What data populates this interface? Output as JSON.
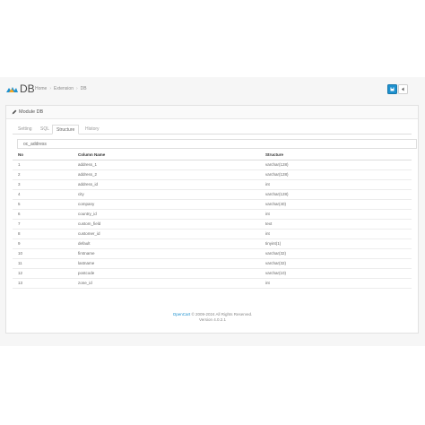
{
  "header": {
    "title": "DB",
    "breadcrumbs": [
      "Home",
      "Extension",
      "DB"
    ]
  },
  "panel": {
    "title": "Module DB"
  },
  "tabs": [
    {
      "label": "Setting",
      "active": false
    },
    {
      "label": "SQL",
      "active": false
    },
    {
      "label": "Structure",
      "active": true
    },
    {
      "label": "History",
      "active": false
    }
  ],
  "search": {
    "value": "oc_address"
  },
  "table": {
    "headers": {
      "no": "No",
      "column": "Column Name",
      "structure": "Structure"
    },
    "rows": [
      {
        "no": "1",
        "column": "address_1",
        "structure": "varchar(128)"
      },
      {
        "no": "2",
        "column": "address_2",
        "structure": "varchar(128)"
      },
      {
        "no": "3",
        "column": "address_id",
        "structure": "int"
      },
      {
        "no": "4",
        "column": "city",
        "structure": "varchar(128)"
      },
      {
        "no": "5",
        "column": "company",
        "structure": "varchar(40)"
      },
      {
        "no": "6",
        "column": "country_id",
        "structure": "int"
      },
      {
        "no": "7",
        "column": "custom_field",
        "structure": "text"
      },
      {
        "no": "8",
        "column": "customer_id",
        "structure": "int"
      },
      {
        "no": "9",
        "column": "default",
        "structure": "tinyint(1)"
      },
      {
        "no": "10",
        "column": "firstname",
        "structure": "varchar(32)"
      },
      {
        "no": "11",
        "column": "lastname",
        "structure": "varchar(32)"
      },
      {
        "no": "12",
        "column": "postcode",
        "structure": "varchar(10)"
      },
      {
        "no": "13",
        "column": "zone_id",
        "structure": "int"
      }
    ]
  },
  "footer": {
    "brand": "OpenCart",
    "copyright": " © 2009-2024 All Rights Reserved.",
    "version": "Version 4.0.2.1"
  },
  "colors": {
    "primary": "#1e91cf",
    "background": "#f6f6f6"
  },
  "icons": {
    "logo": "opencart-logo-icon",
    "save": "save-icon",
    "back": "back-icon",
    "edit": "pencil-icon"
  }
}
